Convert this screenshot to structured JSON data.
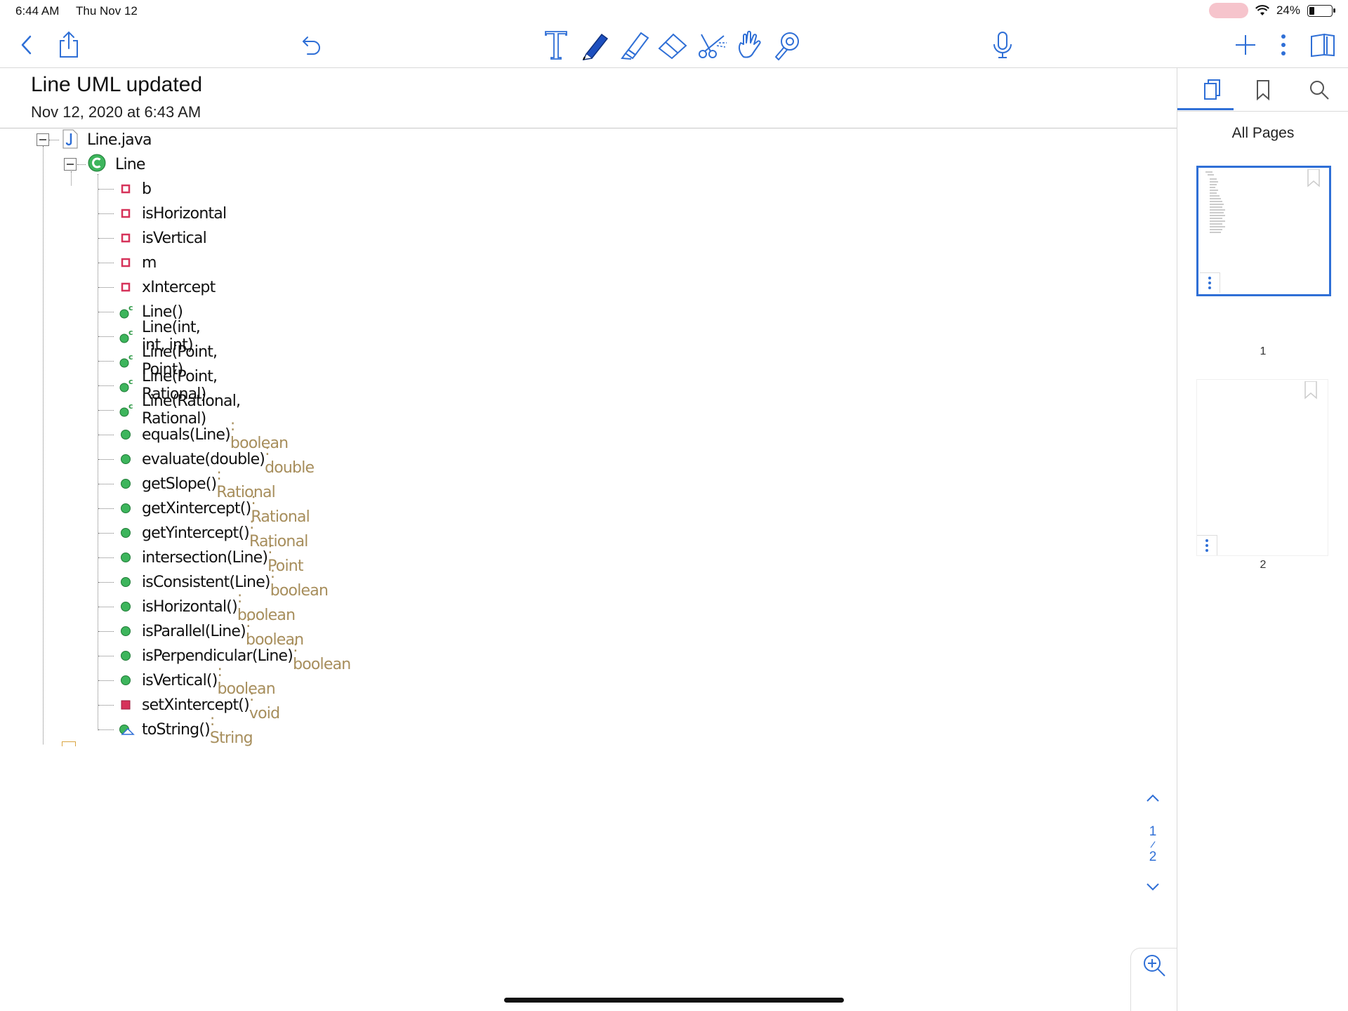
{
  "status_bar": {
    "time": "6:44 AM",
    "date": "Thu Nov 12",
    "battery": "24%"
  },
  "document": {
    "title": "Line UML updated",
    "date": "Nov 12, 2020 at 6:43 AM"
  },
  "colors": {
    "accent": "#2f6fd6",
    "return_type": "#a78e5c",
    "method_public": "#3db55c",
    "field_private": "#d6335a"
  },
  "toolbar_icons": [
    "back-icon",
    "share-icon",
    "undo-icon",
    "text-tool-icon",
    "pen-tool-icon",
    "highlighter-tool-icon",
    "eraser-tool-icon",
    "lasso-scissors-icon",
    "hand-tool-icon",
    "laser-pointer-icon",
    "microphone-icon",
    "add-page-icon",
    "more-options-icon",
    "sidebar-pages-icon"
  ],
  "tree": {
    "file": "Line.java",
    "class": "Line",
    "members": [
      {
        "kind": "field",
        "name": "b",
        "type": ""
      },
      {
        "kind": "field",
        "name": "isHorizontal",
        "type": ""
      },
      {
        "kind": "field",
        "name": "isVertical",
        "type": ""
      },
      {
        "kind": "field",
        "name": "m",
        "type": ""
      },
      {
        "kind": "field",
        "name": "xIntercept",
        "type": ""
      },
      {
        "kind": "constructor",
        "name": "Line()",
        "type": ""
      },
      {
        "kind": "constructor",
        "name": "Line(int, int, int)",
        "type": ""
      },
      {
        "kind": "constructor",
        "name": "Line(Point, Point)",
        "type": ""
      },
      {
        "kind": "constructor",
        "name": "Line(Point, Rational)",
        "type": ""
      },
      {
        "kind": "constructor",
        "name": "Line(Rational, Rational)",
        "type": ""
      },
      {
        "kind": "method",
        "name": "equals(Line)",
        "type": " : boolean"
      },
      {
        "kind": "method",
        "name": "evaluate(double)",
        "type": " : double"
      },
      {
        "kind": "method",
        "name": "getSlope()",
        "type": " : Rational"
      },
      {
        "kind": "method",
        "name": "getXintercept()",
        "type": " : Rational"
      },
      {
        "kind": "method",
        "name": "getYintercept()",
        "type": " : Rational"
      },
      {
        "kind": "method",
        "name": "intersection(Line)",
        "type": " : Point"
      },
      {
        "kind": "method",
        "name": "isConsistent(Line)",
        "type": " : boolean"
      },
      {
        "kind": "method",
        "name": "isHorizontal()",
        "type": " : boolean"
      },
      {
        "kind": "method",
        "name": "isParallel(Line)",
        "type": " : boolean"
      },
      {
        "kind": "method",
        "name": "isPerpendicular(Line)",
        "type": " : boolean"
      },
      {
        "kind": "method",
        "name": "isVertical()",
        "type": " : boolean"
      },
      {
        "kind": "private-method",
        "name": "setXintercept()",
        "type": " : void"
      },
      {
        "kind": "override-method",
        "name": "toString()",
        "type": " : String"
      }
    ]
  },
  "sidebar": {
    "tabs": [
      "pages-tab-icon",
      "bookmarks-tab-icon",
      "search-tab-icon"
    ],
    "heading": "All Pages",
    "pages": [
      "1",
      "2"
    ]
  },
  "page_nav": {
    "current": "1",
    "separator": "/",
    "total": "2"
  }
}
